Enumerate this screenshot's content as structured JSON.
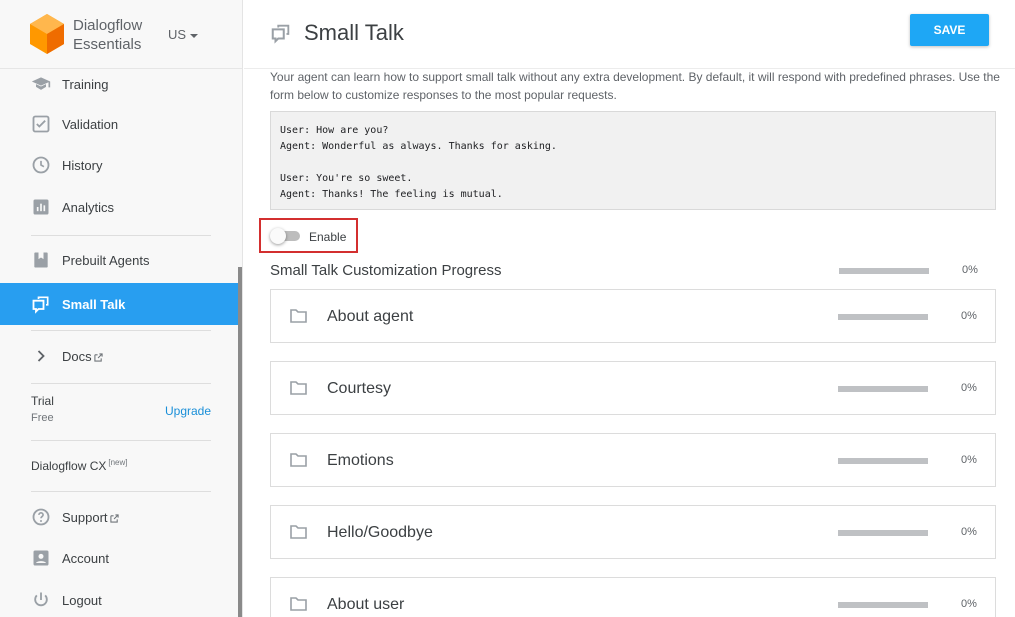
{
  "brand": {
    "line1": "Dialogflow",
    "line2": "Essentials",
    "region": "US",
    "logo_color": "#ff9800"
  },
  "sidebar": {
    "items": [
      {
        "label": "Training",
        "icon": "graduation-cap-icon"
      },
      {
        "label": "Validation",
        "icon": "check-box-icon"
      },
      {
        "label": "History",
        "icon": "clock-icon"
      },
      {
        "label": "Analytics",
        "icon": "bar-chart-icon"
      },
      {
        "label": "Prebuilt Agents",
        "icon": "bookmark-icon"
      },
      {
        "label": "Small Talk",
        "icon": "chat-bubbles-icon",
        "active": true
      },
      {
        "label": "Docs",
        "icon": "chevron-right-icon"
      },
      {
        "label": "Support",
        "icon": "help-circle-icon"
      },
      {
        "label": "Account",
        "icon": "account-box-icon"
      },
      {
        "label": "Logout",
        "icon": "power-icon"
      }
    ],
    "trial_label": "Trial",
    "plan_label": "Free",
    "upgrade_label": "Upgrade",
    "cx_label": "Dialogflow CX",
    "cx_badge": "[new]",
    "active_color": "#289ef0"
  },
  "header": {
    "title": "Small Talk",
    "save_label": "SAVE"
  },
  "main": {
    "description": "Your agent can learn how to support small talk without any extra development. By default, it will respond with predefined phrases. Use the form below to customize responses to the most popular requests.",
    "code_sample": "User: How are you?\nAgent: Wonderful as always. Thanks for asking.\n\nUser: You're so sweet.\nAgent: Thanks! The feeling is mutual.",
    "enable_label": "Enable",
    "enabled": false,
    "progress_title": "Small Talk Customization Progress",
    "overall_progress": "0%",
    "overall_progress_value": 0,
    "categories": [
      {
        "name": "About agent",
        "progress": "0%",
        "progress_value": 0
      },
      {
        "name": "Courtesy",
        "progress": "0%",
        "progress_value": 0
      },
      {
        "name": "Emotions",
        "progress": "0%",
        "progress_value": 0
      },
      {
        "name": "Hello/Goodbye",
        "progress": "0%",
        "progress_value": 0
      },
      {
        "name": "About user",
        "progress": "0%",
        "progress_value": 0
      }
    ]
  }
}
